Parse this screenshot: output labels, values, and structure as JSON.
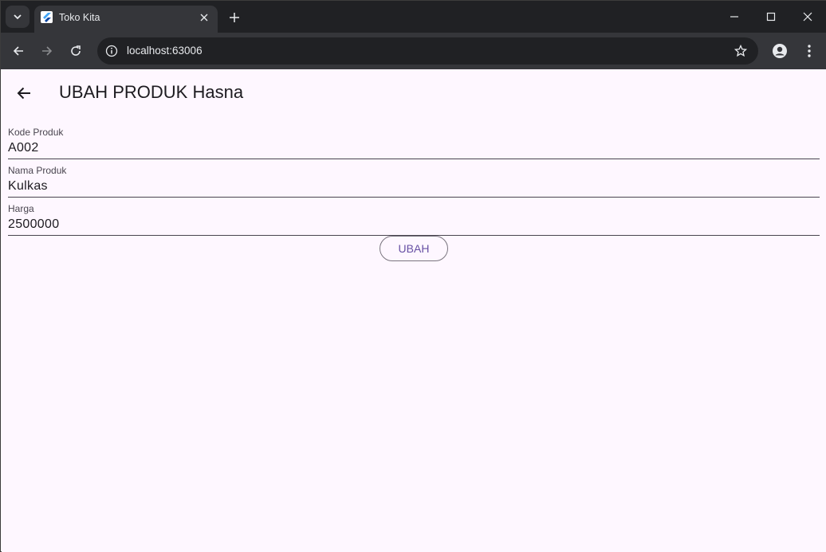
{
  "browser": {
    "tab_title": "Toko Kita",
    "url": "localhost:63006"
  },
  "app": {
    "title": "UBAH PRODUK Hasna",
    "fields": [
      {
        "label": "Kode Produk",
        "value": "A002"
      },
      {
        "label": "Nama Produk",
        "value": "Kulkas"
      },
      {
        "label": "Harga",
        "value": "2500000"
      }
    ],
    "submit_label": "UBAH"
  },
  "colors": {
    "background": "#fef7ff",
    "primary": "#6750a4",
    "browser_frame": "#202124"
  }
}
